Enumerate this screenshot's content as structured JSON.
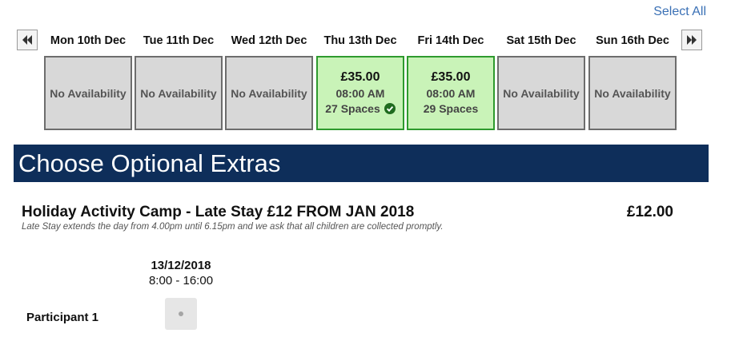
{
  "toolbar": {
    "select_all_label": "Select All"
  },
  "calendar": {
    "prev_icon": "double-chevron-left-icon",
    "next_icon": "double-chevron-right-icon",
    "days": [
      {
        "label": "Mon 10th Dec",
        "status": "No Availability"
      },
      {
        "label": "Tue 11th Dec",
        "status": "No Availability"
      },
      {
        "label": "Wed 12th Dec",
        "status": "No Availability"
      },
      {
        "label": "Thu 13th Dec",
        "price": "£35.00",
        "time": "08:00 AM",
        "spaces": "27 Spaces",
        "selected": true
      },
      {
        "label": "Fri 14th Dec",
        "price": "£35.00",
        "time": "08:00 AM",
        "spaces": "29 Spaces"
      },
      {
        "label": "Sat 15th Dec",
        "status": "No Availability"
      },
      {
        "label": "Sun 16th Dec",
        "status": "No Availability"
      }
    ],
    "colors": {
      "available_bg": "#c9f3b8",
      "available_border": "#2e9a2e",
      "unavailable_bg": "#d8d8d8",
      "check_icon": "#1f6b1f"
    }
  },
  "extras": {
    "heading": "Choose Optional Extras",
    "banner_color": "#0e2e5a",
    "item": {
      "title": "Holiday Activity Camp - Late Stay £12 FROM JAN 2018",
      "price": "£12.00",
      "description": "Late Stay extends the day from 4.00pm until 6.15pm and we ask that all children are collected promptly.",
      "session": {
        "date": "13/12/2018",
        "time": "8:00 - 16:00"
      },
      "participants": [
        {
          "label": "Participant 1",
          "selected": false
        }
      ]
    }
  }
}
